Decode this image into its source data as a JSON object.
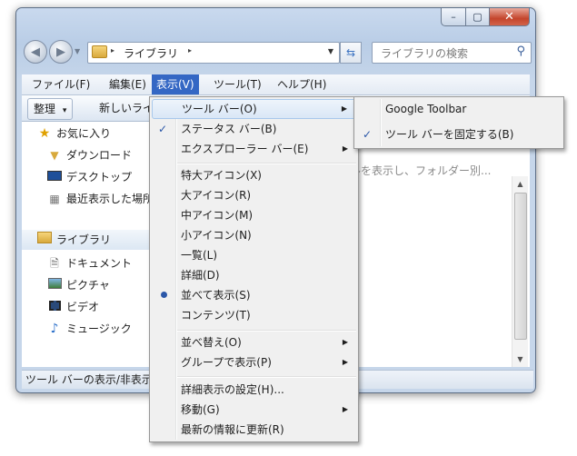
{
  "window": {
    "caption_buttons": {
      "minimize": "–",
      "maximize": "▢",
      "close": "✕"
    },
    "address": {
      "path": "ライブラリ",
      "separator": "▸"
    },
    "search": {
      "placeholder": "ライブラリの検索"
    }
  },
  "menubar": {
    "items": [
      {
        "label": "ファイル(F)"
      },
      {
        "label": "編集(E)"
      },
      {
        "label": "表示(V)"
      },
      {
        "label": "ツール(T)"
      },
      {
        "label": "ヘルプ(H)"
      }
    ]
  },
  "command_bar": {
    "organize": "整理",
    "organize_arrow": "▾",
    "new_library": "新しいライ"
  },
  "nav_pane": {
    "favorites_header": "お気に入り",
    "favorites": [
      "ダウンロード",
      "デスクトップ",
      "最近表示した場所"
    ],
    "libraries_header": "ライブラリ",
    "libraries": [
      "ドキュメント",
      "ピクチャ",
      "ビデオ",
      "ミュージック"
    ]
  },
  "content": {
    "hint": "ルを表示し、フォルダー別..."
  },
  "status_bar": {
    "text": "ツール バーの表示/非表示"
  },
  "view_menu": {
    "items": [
      {
        "label": "ツール バー(O)",
        "submenu": true
      },
      {
        "label": "ステータス バー(B)",
        "checked": true
      },
      {
        "label": "エクスプローラー バー(E)",
        "submenu": true
      },
      {
        "label": "特大アイコン(X)"
      },
      {
        "label": "大アイコン(R)"
      },
      {
        "label": "中アイコン(M)"
      },
      {
        "label": "小アイコン(N)"
      },
      {
        "label": "一覧(L)"
      },
      {
        "label": "詳細(D)"
      },
      {
        "label": "並べて表示(S)",
        "selected": true
      },
      {
        "label": "コンテンツ(T)"
      },
      {
        "label": "並べ替え(O)",
        "submenu": true
      },
      {
        "label": "グループで表示(P)",
        "submenu": true
      },
      {
        "label": "詳細表示の設定(H)..."
      },
      {
        "label": "移動(G)",
        "submenu": true
      },
      {
        "label": "最新の情報に更新(R)"
      }
    ]
  },
  "toolbar_submenu": {
    "items": [
      {
        "label": "Google Toolbar"
      },
      {
        "label": "ツール バーを固定する(B)",
        "checked": true
      }
    ]
  },
  "glyphs": {
    "check": "✓",
    "arrow": "▶"
  }
}
